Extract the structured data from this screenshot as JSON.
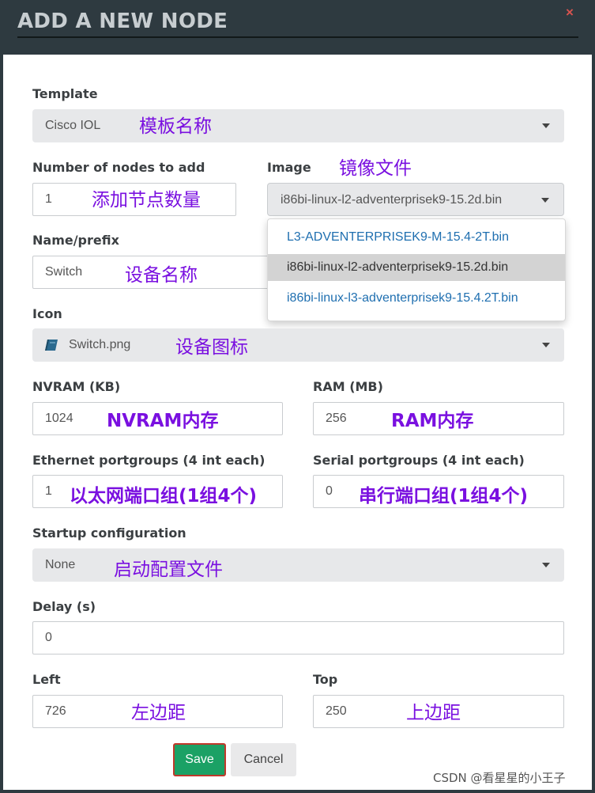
{
  "header": {
    "title": "ADD A NEW NODE",
    "close": "×"
  },
  "template": {
    "label": "Template",
    "value": "Cisco IOL",
    "note": "模板名称"
  },
  "nodes": {
    "label": "Number of nodes to add",
    "value": "1",
    "note": "添加节点数量"
  },
  "image": {
    "label": "Image",
    "value": "i86bi-linux-l2-adventerprisek9-15.2d.bin",
    "note": "镜像文件",
    "options": [
      "L3-ADVENTERPRISEK9-M-15.4-2T.bin",
      "i86bi-linux-l2-adventerprisek9-15.2d.bin",
      "i86bi-linux-l3-adventerprisek9-15.4.2T.bin"
    ]
  },
  "name": {
    "label": "Name/prefix",
    "value": "Switch",
    "note": "设备名称"
  },
  "icon": {
    "label": "Icon",
    "value": "Switch.png",
    "note": "设备图标",
    "icon_name": "book-icon",
    "icon_color": "#2b6a8f"
  },
  "nvram": {
    "label": "NVRAM (KB)",
    "value": "1024",
    "note": "NVRAM内存"
  },
  "ram": {
    "label": "RAM (MB)",
    "value": "256",
    "note": "RAM内存"
  },
  "ethernet": {
    "label": "Ethernet portgroups (4 int each)",
    "value": "1",
    "note": "以太网端口组(1组4个)"
  },
  "serial": {
    "label": "Serial portgroups (4 int each)",
    "value": "0",
    "note": "串行端口组(1组4个)"
  },
  "startup": {
    "label": "Startup configuration",
    "value": "None",
    "note": "启动配置文件"
  },
  "delay": {
    "label": "Delay (s)",
    "value": "0"
  },
  "left": {
    "label": "Left",
    "value": "726",
    "note": "左边距"
  },
  "top": {
    "label": "Top",
    "value": "250",
    "note": "上边距"
  },
  "buttons": {
    "save": "Save",
    "cancel": "Cancel"
  },
  "watermark": "CSDN @看星星的小王子",
  "colors": {
    "header_bg": "#2e3a40",
    "save_bg": "#1ba165",
    "note": "#7a10e0",
    "link": "#1f6fb0"
  }
}
